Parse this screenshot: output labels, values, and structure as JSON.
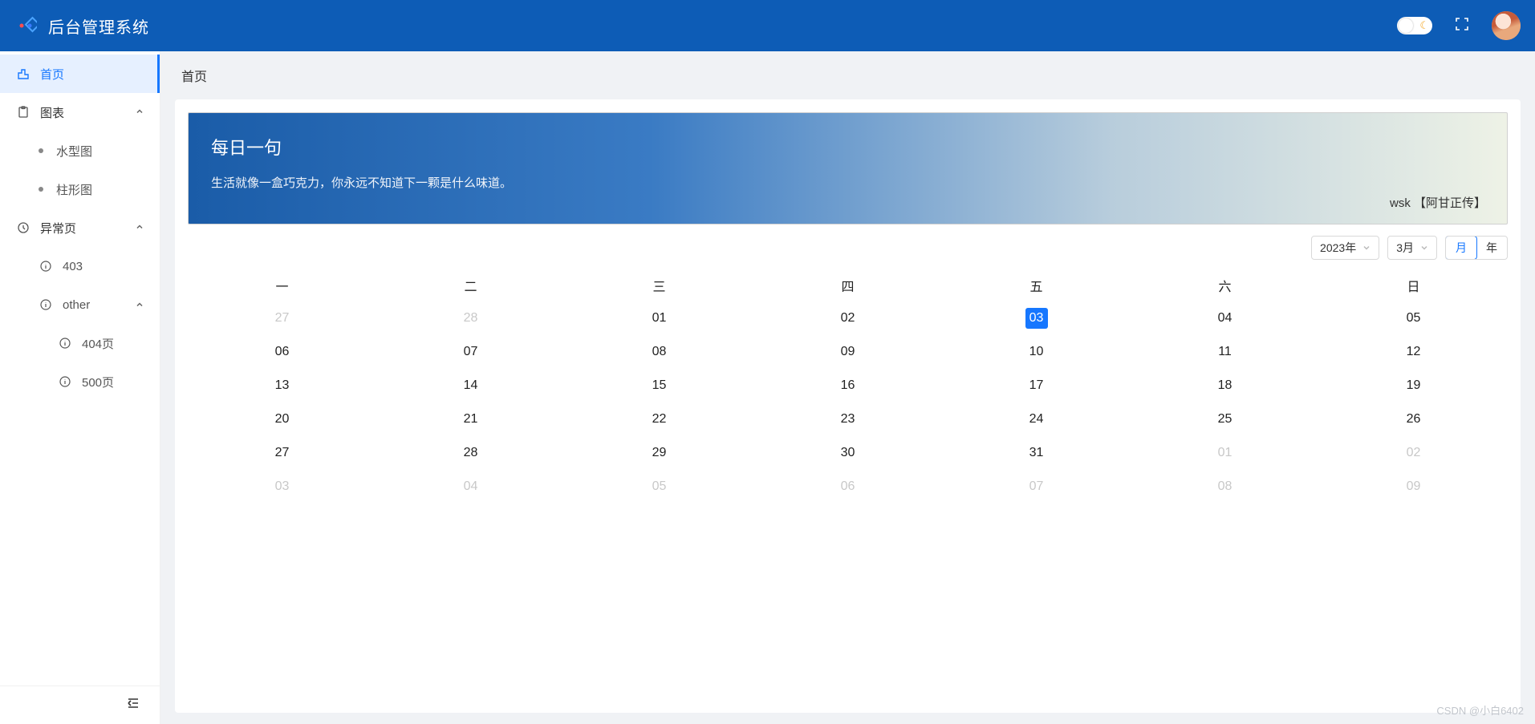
{
  "header": {
    "title": "后台管理系统"
  },
  "sidebar": {
    "home": "首页",
    "charts": "图表",
    "charts_children": {
      "water": "水型图",
      "bar": "柱形图"
    },
    "error": "异常页",
    "error_children": {
      "p403": "403",
      "other": "other",
      "p404": "404页",
      "p500": "500页"
    }
  },
  "breadcrumb": "首页",
  "quote": {
    "title": "每日一句",
    "text": "生活就像一盒巧克力，你永远不知道下一颗是什么味道。",
    "attrib": "wsk 【阿甘正传】"
  },
  "calendar": {
    "year_label": "2023年",
    "month_label": "3月",
    "mode_month": "月",
    "mode_year": "年",
    "weekdays": [
      "一",
      "二",
      "三",
      "四",
      "五",
      "六",
      "日"
    ],
    "weeks": [
      [
        {
          "d": "27",
          "other": true
        },
        {
          "d": "28",
          "other": true
        },
        {
          "d": "01"
        },
        {
          "d": "02"
        },
        {
          "d": "03",
          "today": true
        },
        {
          "d": "04"
        },
        {
          "d": "05"
        }
      ],
      [
        {
          "d": "06"
        },
        {
          "d": "07"
        },
        {
          "d": "08"
        },
        {
          "d": "09"
        },
        {
          "d": "10"
        },
        {
          "d": "11"
        },
        {
          "d": "12"
        }
      ],
      [
        {
          "d": "13"
        },
        {
          "d": "14"
        },
        {
          "d": "15"
        },
        {
          "d": "16"
        },
        {
          "d": "17"
        },
        {
          "d": "18"
        },
        {
          "d": "19"
        }
      ],
      [
        {
          "d": "20"
        },
        {
          "d": "21"
        },
        {
          "d": "22"
        },
        {
          "d": "23"
        },
        {
          "d": "24"
        },
        {
          "d": "25"
        },
        {
          "d": "26"
        }
      ],
      [
        {
          "d": "27"
        },
        {
          "d": "28"
        },
        {
          "d": "29"
        },
        {
          "d": "30"
        },
        {
          "d": "31"
        },
        {
          "d": "01",
          "other": true
        },
        {
          "d": "02",
          "other": true
        }
      ],
      [
        {
          "d": "03",
          "other": true
        },
        {
          "d": "04",
          "other": true
        },
        {
          "d": "05",
          "other": true
        },
        {
          "d": "06",
          "other": true
        },
        {
          "d": "07",
          "other": true
        },
        {
          "d": "08",
          "other": true
        },
        {
          "d": "09",
          "other": true
        }
      ]
    ]
  },
  "watermark": "CSDN @小白6402"
}
